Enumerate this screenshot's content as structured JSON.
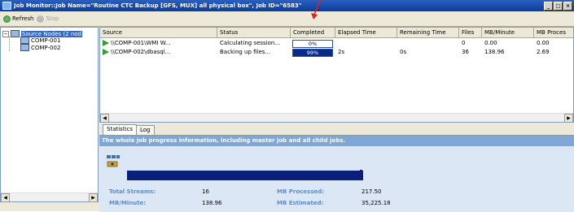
{
  "window": {
    "title": "Job Monitor::Job Name=\"Routine CTC Backup [GFS, MUX] all physical box\", Job ID=\"6583\"",
    "controls": [
      "_",
      "□",
      "×"
    ]
  },
  "toolbar": {
    "refresh_label": "Refresh",
    "stop_label": "Stop"
  },
  "tree": {
    "root_label": "Source Nodes (2 nod",
    "children": [
      "COMP-001",
      "COMP-002"
    ]
  },
  "grid": {
    "columns": [
      "Source",
      "Status",
      "Completed",
      "Elapsed Time",
      "Remaining Time",
      "Files",
      "MB/Minute",
      "MB Proces"
    ],
    "rows": [
      {
        "source": "\\\\COMP-001\\WMI W...",
        "status": "Calculating session...",
        "completed_text": "0%",
        "completed": 0,
        "elapsed": "",
        "remaining": "",
        "files": "0",
        "mb_minute": "0.00",
        "mb_processed": "0.00"
      },
      {
        "source": "\\\\COMP-002\\dbasql...",
        "status": "Backing up files...",
        "completed_text": "99%",
        "completed": 99,
        "elapsed": "2s",
        "remaining": "0s",
        "files": "36",
        "mb_minute": "138.96",
        "mb_processed": "2.69"
      }
    ]
  },
  "tabs": [
    "Statistics",
    "Log"
  ],
  "statistics": {
    "banner": "The whole job progress information, including master job and all child jobs.",
    "overall_progress": 0.99,
    "total_streams_label": "Total Streams:",
    "total_streams_value": "16",
    "mb_minute_label": "MB/Minute:",
    "mb_minute_value": "138.96",
    "mb_processed_label": "MB Processed:",
    "mb_processed_value": "217.50",
    "mb_estimated_label": "MB Estimated:",
    "mb_estimated_value": "35,225.18"
  },
  "colors": {
    "titlebar": "#0b3c99",
    "progress": "#0a2a8a",
    "banner": "#7ea6d6",
    "stat_label": "#5b8fd0",
    "annotation_arrow": "#e02020"
  }
}
